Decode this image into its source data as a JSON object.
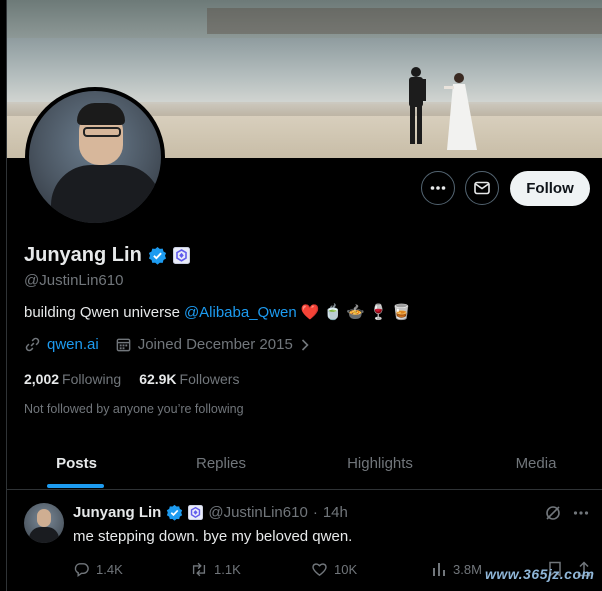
{
  "profile": {
    "display_name": "Junyang Lin",
    "handle": "@JustinLin610",
    "bio_prefix": "building Qwen universe",
    "bio_mention": "@Alibaba_Qwen",
    "bio_emoji": "❤️ 🍵 🍲 🍷 🥃",
    "website": "qwen.ai",
    "joined": "Joined December 2015",
    "following_count": "2,002",
    "following_label": "Following",
    "followers_count": "62.9K",
    "followers_label": "Followers",
    "not_followed_text": "Not followed by anyone you’re following",
    "verified_color": "#1d9bf0"
  },
  "actions": {
    "more_icon": "more-icon",
    "message_icon": "mail-icon",
    "follow_label": "Follow"
  },
  "tabs": [
    {
      "label": "Posts",
      "active": true
    },
    {
      "label": "Replies",
      "active": false
    },
    {
      "label": "Highlights",
      "active": false
    },
    {
      "label": "Media",
      "active": false
    }
  ],
  "post": {
    "author_name": "Junyang Lin",
    "author_handle": "@JustinLin610",
    "separator": "·",
    "time": "14h",
    "text": "me stepping down. bye my beloved qwen.",
    "replies": "1.4K",
    "reposts": "1.1K",
    "likes": "10K",
    "views": "3.8M"
  },
  "watermark": "www.365jz.com",
  "colors": {
    "background": "#000000",
    "accent": "#1d9bf0",
    "muted": "#71767b",
    "text": "#e7e9ea"
  }
}
